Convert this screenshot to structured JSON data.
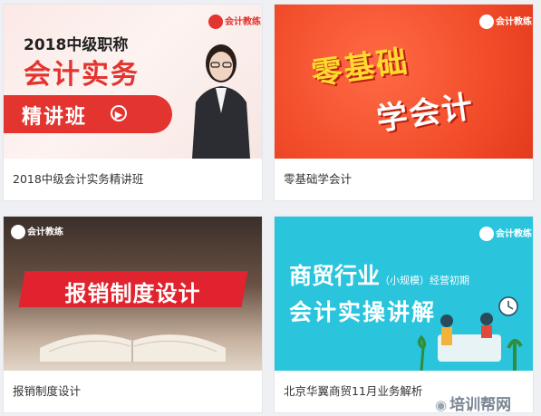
{
  "courses": [
    {
      "caption": "2018中级会计实务精讲班",
      "thumb": {
        "year_line": "2018中级职称",
        "subject_line": "会计实务",
        "banner": "精讲班",
        "logo": "会计教练"
      }
    },
    {
      "caption": "零基础学会计",
      "thumb": {
        "line1": "零基础",
        "line2": "学会计",
        "logo": "会计教练"
      }
    },
    {
      "caption": "报销制度设计",
      "thumb": {
        "banner": "报销制度设计",
        "logo": "会计教练"
      }
    },
    {
      "caption": "北京华翼商贸11月业务解析",
      "thumb": {
        "line1_main": "商贸行业",
        "line1_small": "（小规模）经营初期",
        "line2": "会计实操讲解",
        "logo": "会计教练"
      }
    }
  ],
  "watermark": {
    "icon": "eye-icon",
    "text": "培训帮网"
  },
  "colors": {
    "accent_red": "#e3342f",
    "teal": "#2ac4dd",
    "orange": "#f24d2b"
  }
}
